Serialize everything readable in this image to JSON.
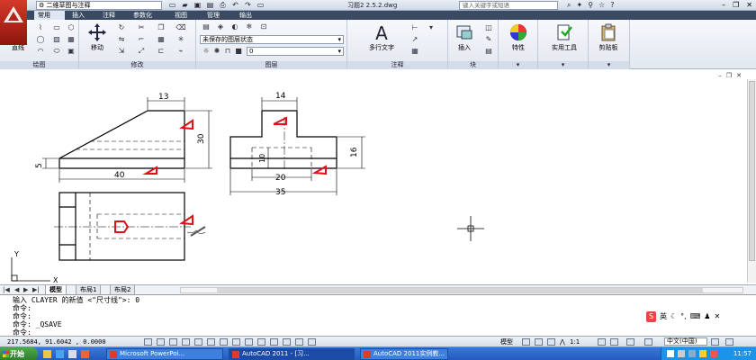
{
  "titlebar": {
    "workspace": "二维草图与注释",
    "doc_title": "习题2 2.5.2.dwg",
    "search_placeholder": "键入关键字或短语"
  },
  "tabs": [
    "常用",
    "插入",
    "注释",
    "参数化",
    "视图",
    "管理",
    "输出"
  ],
  "ribbon": {
    "draw": {
      "line_label": "直线",
      "panel_label": "绘图"
    },
    "modify": {
      "move_label": "移动",
      "panel_label": "修改"
    },
    "layers": {
      "layer_state": "未保存的图层状态",
      "current_layer": "0",
      "panel_label": "图层"
    },
    "annotation": {
      "mtext_label": "多行文字",
      "panel_label": "注释"
    },
    "block": {
      "insert_label": "插入",
      "panel_label": "块"
    },
    "properties_label": "特性",
    "utilities_label": "实用工具",
    "clipboard_label": "剪贴板"
  },
  "drawing": {
    "dim_13": "13",
    "dim_30": "30",
    "dim_5": "5",
    "dim_40": "40",
    "dim_14": "14",
    "dim_10": "10",
    "dim_20": "20",
    "dim_16": "16",
    "dim_35": "35",
    "ucs_x": "X",
    "ucs_y": "Y",
    "annotation_color": "#e0101a"
  },
  "layout_tabs": [
    "模型",
    "布局1",
    "布局2"
  ],
  "command": {
    "lines": [
      "输入 CLAYER 的新值 <\"尺寸线\">: 0",
      "命令:",
      "命令:",
      "命令: _QSAVE",
      "命令:"
    ]
  },
  "ime": {
    "lang": "英"
  },
  "status": {
    "coords": "217.5684, 91.6042 , 0.0000",
    "model": "模型",
    "scale": "1:1"
  },
  "taskbar": {
    "start": "开始",
    "tasks": [
      "Microsoft PowerPoi...",
      "AutoCAD 2011 - [习...",
      "AutoCAD 2011实例教..."
    ],
    "ime": "中文(中国)",
    "clock": "11:57"
  }
}
